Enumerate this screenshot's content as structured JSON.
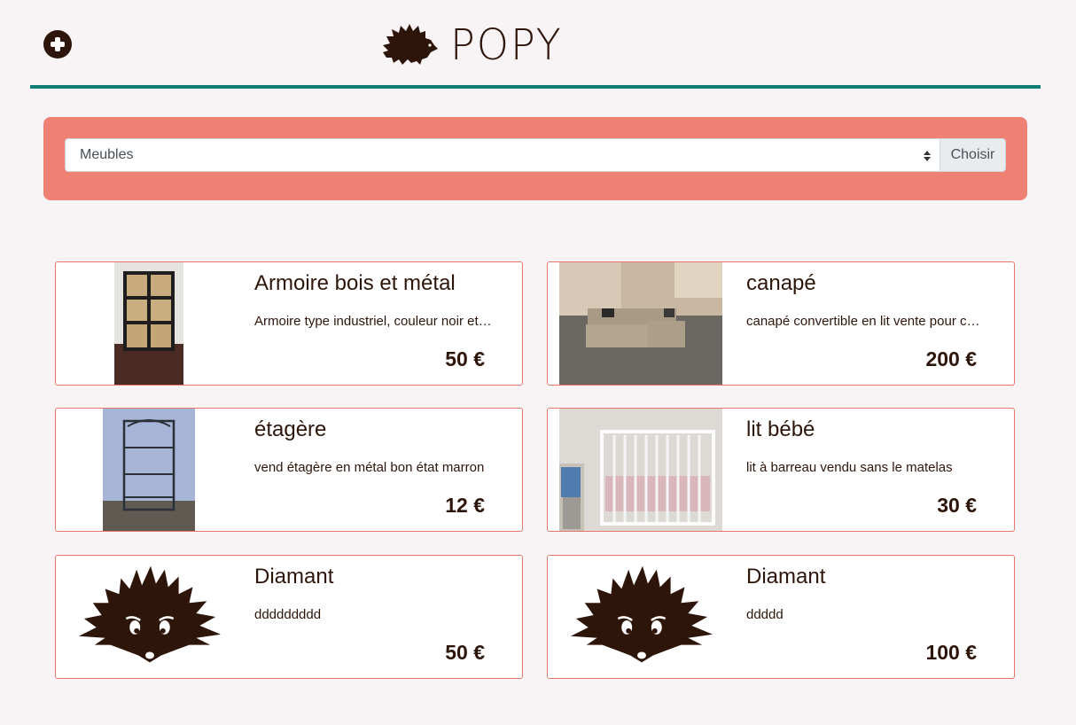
{
  "header": {
    "add_icon": "plus-circle-icon",
    "logo_icon": "hedgehog-icon",
    "logo_text": "POPY",
    "accent_color": "#0e7d74"
  },
  "filter": {
    "selected_category": "Meubles",
    "choose_label": "Choisir",
    "panel_color": "#ef8174"
  },
  "listings": [
    {
      "title": "Armoire bois et métal",
      "description": "Armoire type industriel, couleur noir et bois",
      "price": "50 €",
      "image": "wardrobe-photo"
    },
    {
      "title": "canapé",
      "description": "canapé convertible en lit vente pour cause de déménagement",
      "price": "200 €",
      "image": "sofa-photo"
    },
    {
      "title": "étagère",
      "description": "vend étagère en métal bon état marron",
      "price": "12 €",
      "image": "shelf-photo"
    },
    {
      "title": "lit bébé",
      "description": "lit à barreau vendu sans le matelas",
      "price": "30 €",
      "image": "crib-photo"
    },
    {
      "title": "Diamant",
      "description": "ddddddddd",
      "price": "50 €",
      "image": "hedgehog-placeholder"
    },
    {
      "title": "Diamant",
      "description": "ddddd",
      "price": "100 €",
      "image": "hedgehog-placeholder"
    }
  ]
}
